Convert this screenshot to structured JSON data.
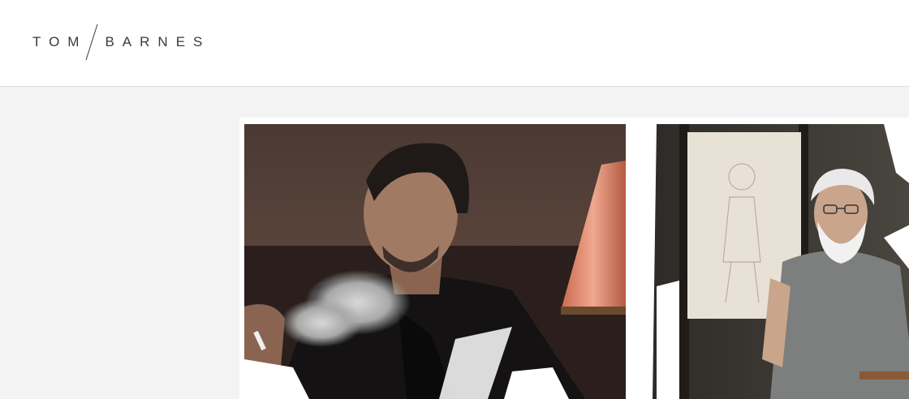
{
  "header": {
    "logo": {
      "first": "TOM",
      "last": "BARNES"
    }
  },
  "gallery": {
    "items": [
      {
        "id": "portrait-smoking-man"
      },
      {
        "id": "portrait-artist-easel"
      }
    ]
  }
}
